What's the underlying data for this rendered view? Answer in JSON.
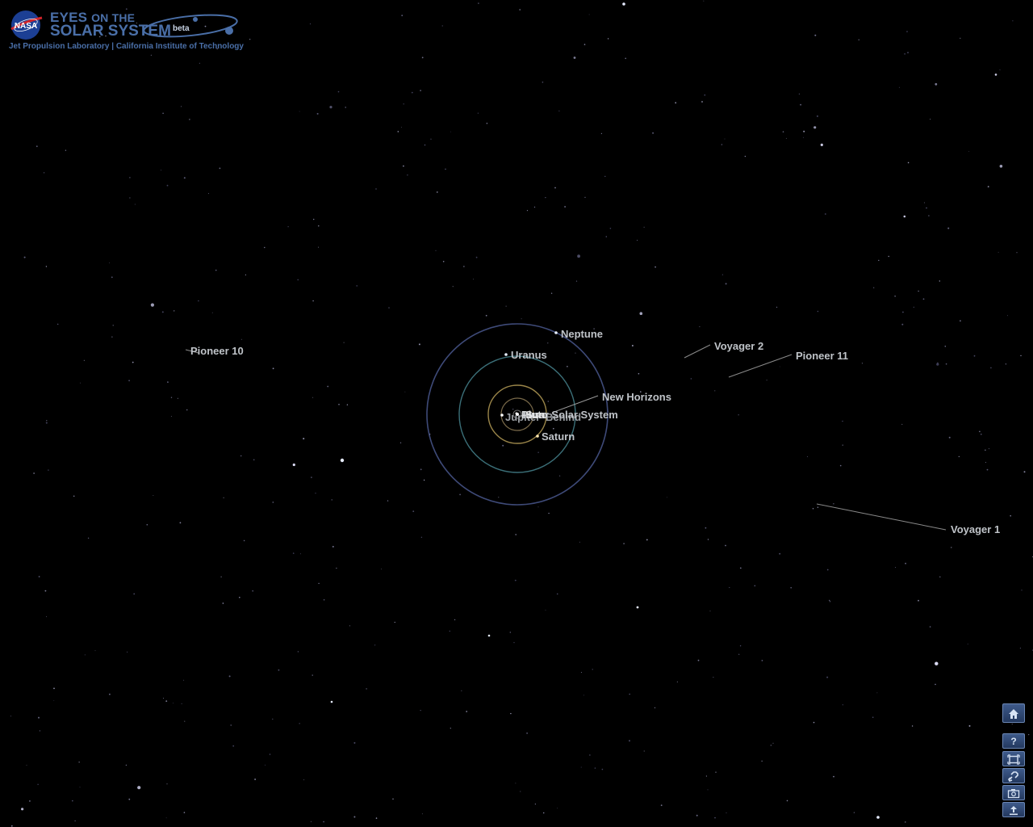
{
  "app": {
    "logo_badge": "NASA",
    "title_line1_a": "EYES",
    "title_line1_b": "ON THE",
    "title_line2": "SOLAR SYSTEM",
    "beta_tag": "beta",
    "subtitle": "Jet Propulsion Laboratory | California Institute of Technology"
  },
  "labels": {
    "neptune": "Neptune",
    "uranus": "Uranus",
    "new_horizons": "New Horizons",
    "inner_solar_system": "Inner Solar System",
    "jupiter": "Jupiter",
    "pluto": "Pluto",
    "saturn": "Saturn",
    "voyager2": "Voyager 2",
    "pioneer11": "Pioneer 11",
    "pioneer10": "Pioneer 10",
    "voyager1": "Voyager 1",
    "overlap_fragment": "Sun",
    "overlap_fragment2": "Behind"
  },
  "toolbar": {
    "help_label": "?"
  },
  "colors": {
    "background": "#000000",
    "brand_blue": "#4a6fa8",
    "label_gray": "#bfc3c8",
    "orbit_neptune": "#3e4a78",
    "orbit_uranus": "#3b6f78",
    "orbit_saturn": "#8d7a45",
    "orbit_jupiter": "#7a6a4a",
    "button_blue": "#2d4673"
  }
}
